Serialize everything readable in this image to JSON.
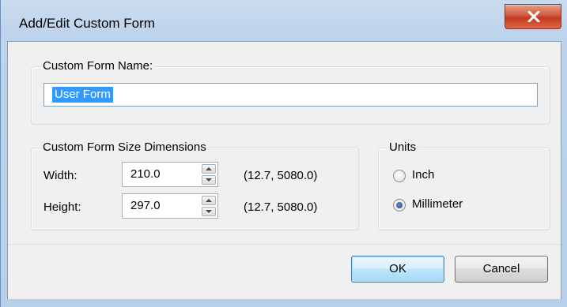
{
  "window": {
    "title": "Add/Edit Custom Form"
  },
  "name_group": {
    "legend": "Custom Form Name:",
    "input_value": "User Form"
  },
  "size_group": {
    "legend": "Custom Form Size Dimensions",
    "width_label": "Width:",
    "width_value": "210.0",
    "width_range": "(12.7, 5080.0)",
    "height_label": "Height:",
    "height_value": "297.0",
    "height_range": "(12.7, 5080.0)"
  },
  "units_group": {
    "legend": "Units",
    "options": [
      {
        "label": "Inch",
        "checked": false
      },
      {
        "label": "Millimeter",
        "checked": true
      }
    ]
  },
  "buttons": {
    "ok": "OK",
    "cancel": "Cancel"
  },
  "colors": {
    "selection": "#3399ff",
    "close_button": "#c5391c",
    "default_button_border": "#3c7fb1"
  },
  "icons": {
    "close": "close-icon",
    "spin_up": "chevron-up-icon",
    "spin_down": "chevron-down-icon"
  }
}
